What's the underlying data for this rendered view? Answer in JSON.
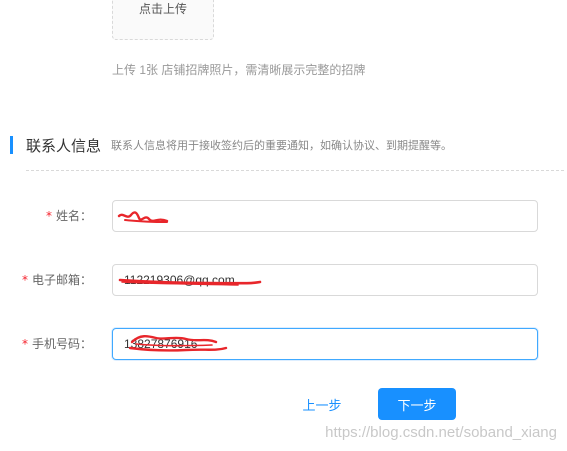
{
  "upload": {
    "button_label": "点击上传",
    "hint": "上传 1张 店铺招牌照片，需清晰展示完整的招牌"
  },
  "contact_section": {
    "title": "联系人信息",
    "description": "联系人信息将用于接收签约后的重要通知，如确认协议、到期提醒等。"
  },
  "form": {
    "name": {
      "required_mark": "*",
      "label": "姓名：",
      "value": ""
    },
    "email": {
      "required_mark": "*",
      "label": "电子邮箱：",
      "value": "112219306@qq.com"
    },
    "phone": {
      "required_mark": "*",
      "label": "手机号码：",
      "value": "13827876916"
    }
  },
  "actions": {
    "prev_label": "上一步",
    "next_label": "下一步"
  },
  "watermark": "https://blog.csdn.net/soband_xiang",
  "colors": {
    "primary": "#1890ff",
    "required": "#f5222d",
    "redaction": "#e8262b"
  }
}
